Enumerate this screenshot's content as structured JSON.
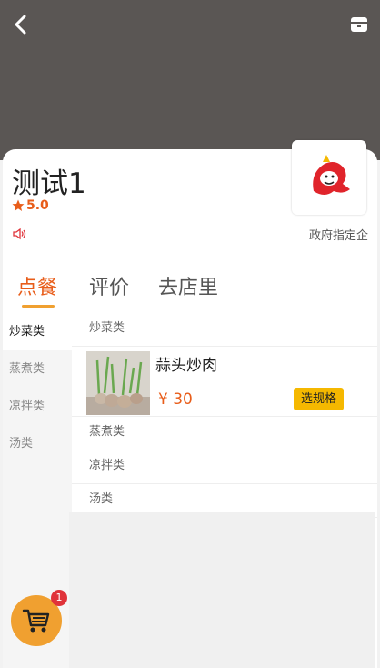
{
  "header": {
    "back_icon": "chevron-left-icon",
    "store_icon": "store-icon"
  },
  "store": {
    "name": "测试1",
    "rating": "5.0",
    "notice": "政府指定企",
    "logo_icon": "red-horse-logo"
  },
  "tabs": [
    {
      "label": "点餐",
      "active": true
    },
    {
      "label": "评价",
      "active": false
    },
    {
      "label": "去店里",
      "active": false
    }
  ],
  "categories": [
    {
      "label": "炒菜类",
      "active": true
    },
    {
      "label": "蒸煮类",
      "active": false
    },
    {
      "label": "凉拌类",
      "active": false
    },
    {
      "label": "汤类",
      "active": false
    }
  ],
  "sections": [
    {
      "title": "炒菜类",
      "dishes": [
        {
          "name": "蒜头炒肉",
          "price": "¥ 30",
          "button": "选规格"
        }
      ]
    },
    {
      "title": "蒸煮类",
      "dishes": []
    },
    {
      "title": "凉拌类",
      "dishes": []
    },
    {
      "title": "汤类",
      "dishes": []
    }
  ],
  "cart": {
    "count": "1",
    "icon": "cart-icon"
  },
  "colors": {
    "accent": "#e85d1a",
    "button": "#f5b800",
    "cart": "#f0a030",
    "badge": "#e0333a"
  }
}
